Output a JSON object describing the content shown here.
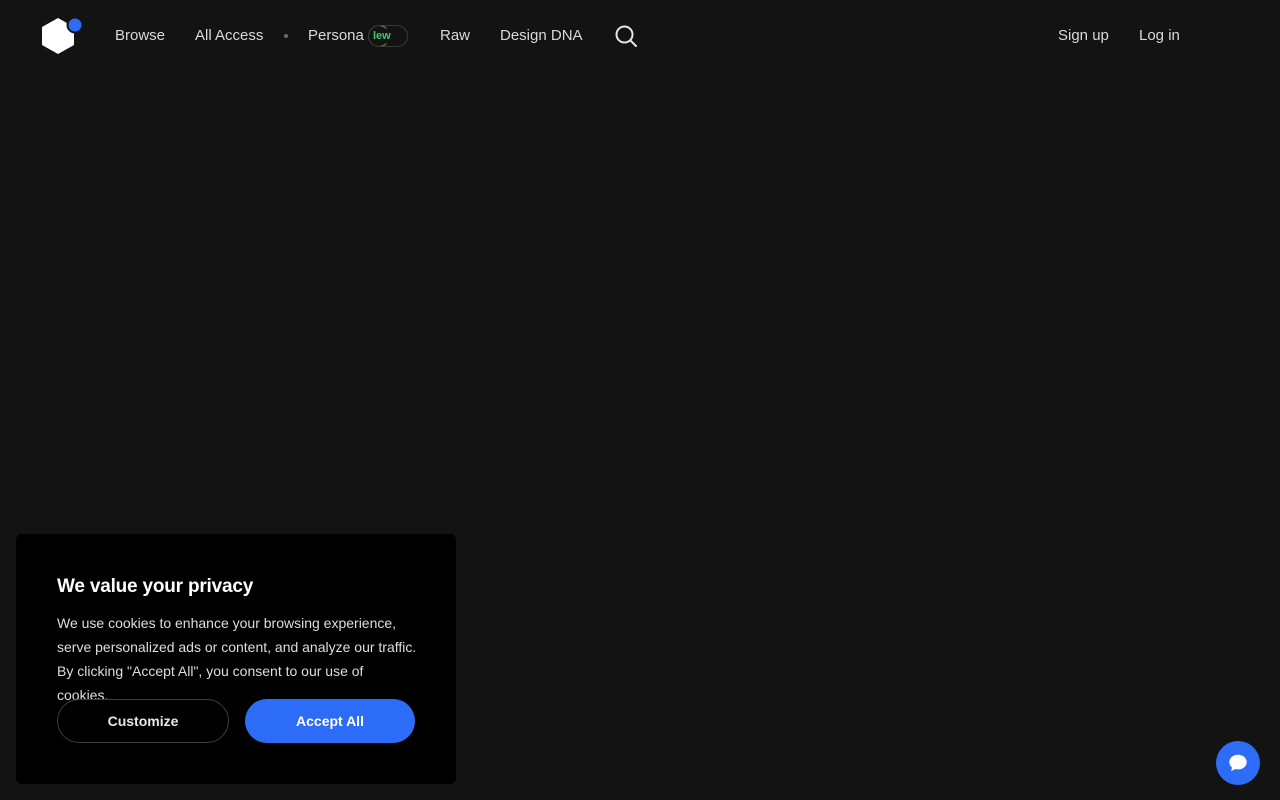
{
  "nav": {
    "items": [
      {
        "label": "Browse"
      },
      {
        "label": "All Access"
      },
      {
        "label": "Persona"
      },
      {
        "label": "Raw"
      },
      {
        "label": "Design DNA"
      }
    ],
    "persona_badge": "lew",
    "signup_label": "Sign up",
    "login_label": "Log in"
  },
  "cookie_banner": {
    "title": "We value your privacy",
    "body": "We use cookies to enhance your browsing experience, serve personalized ads or content, and analyze our traffic. By clicking \"Accept All\", you consent to our use of cookies.",
    "customize_label": "Customize",
    "accept_label": "Accept All"
  },
  "colors": {
    "background": "#131313",
    "accent": "#2d6cf6",
    "badge_green": "#4cc56a"
  },
  "icons": {
    "logo": "brand-logo-icon",
    "search": "search-icon",
    "chat": "chat-bubble-icon"
  }
}
